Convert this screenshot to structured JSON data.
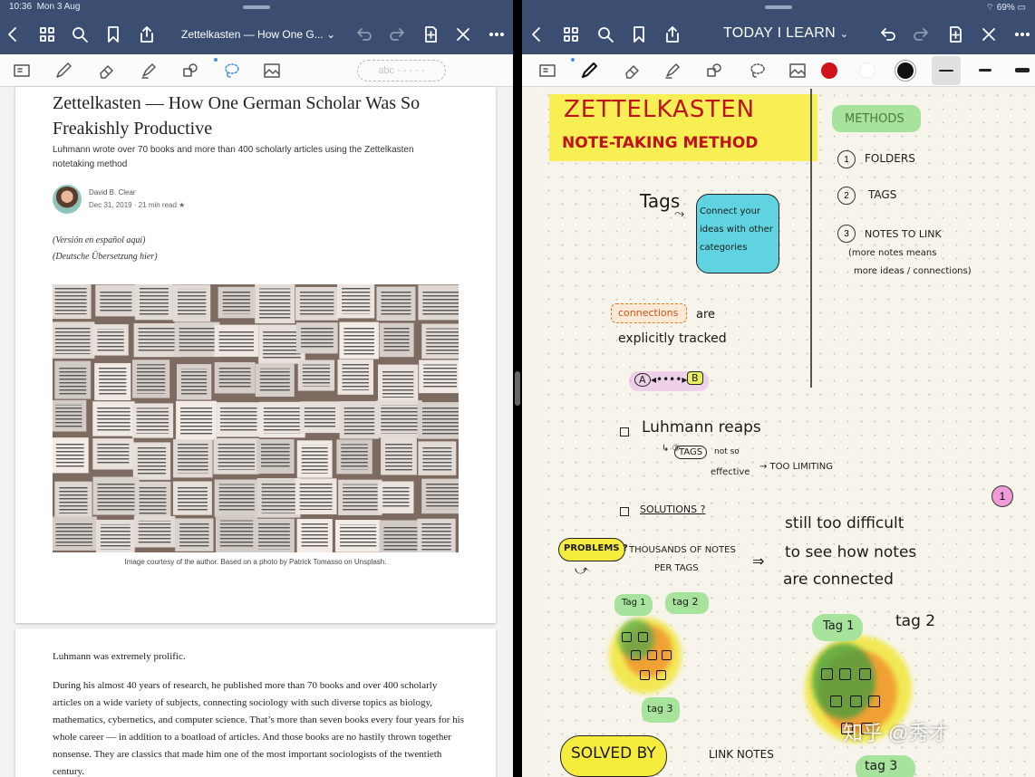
{
  "status": {
    "time": "10:36",
    "date": "Mon 3 Aug",
    "battery": "69%"
  },
  "left": {
    "doc_title": "Zettelkasten — How One G...",
    "article": {
      "title": "Zettelkasten — How One German Scholar Was So Freakishly Productive",
      "subtitle": "Luhmann wrote over 70 books and more than 400 scholarly articles using the Zettelkasten notetaking method",
      "author": "David B. Clear",
      "meta": "Dec 31, 2019 · 21 min read ★",
      "alt_spanish": "(Versión en español aquí)",
      "alt_german": "(Deutsche Übersetzung hier)",
      "caption": "Image courtesy of the author. Based on a photo by Patrick Tomasso on Unsplash.",
      "p1": "Luhmann was extremely prolific.",
      "p2": "During his almost 40 years of research, he published more than 70 books and over 400 scholarly articles on a wide variety of subjects, connecting sociology with such diverse topics as biology, mathematics, cybernetics, and computer science. That’s more than seven books every four years for his whole career — in addition to a boatload of articles. And those books are no hastily thrown together nonsense. They are classics that made him one of the most important sociologists of the twentieth century."
    },
    "text_tool_placeholder": "abc"
  },
  "right": {
    "doc_title": "TODAY I LEARN",
    "colors": {
      "red": "#d0131a",
      "white": "#ffffff",
      "black": "#111111"
    },
    "notes": {
      "heading1": "ZETTELKASTEN",
      "heading2": "NOTE-TAKING METHOD",
      "methods": "METHODS",
      "m1": "FOLDERS",
      "m2": "TAGS",
      "m3": "NOTES TO LINK",
      "m3a": "(more notes means",
      "m3b": "more ideas / connections)",
      "n1": "1",
      "n2": "2",
      "n3": "3",
      "tags": "Tags",
      "connect": "Connect your ideas with other categories",
      "connections": "connections",
      "are": "are",
      "explicitly": "explicitly tracked",
      "a": "A",
      "b": "B",
      "luhmann": "Luhmann reaps",
      "tags_box": "TAGS",
      "not_so": "not so",
      "effective": "effective",
      "too_limiting": "→ TOO LIMITING",
      "solutions": "SOLUTIONS ?",
      "problems": "PROBLEMS ?",
      "thousands": "THOUSANDS OF NOTES",
      "per_tags": "PER TAGS",
      "still1": "still too difficult",
      "still2": "to see how notes",
      "still3": "are connected",
      "tag1": "Tag 1",
      "tag2": "tag 2",
      "tag3": "tag 3",
      "solved_by": "SOLVED BY",
      "link_notes": "LINK NOTES",
      "margin_1": "1"
    }
  },
  "watermark": "知乎 @秀才"
}
